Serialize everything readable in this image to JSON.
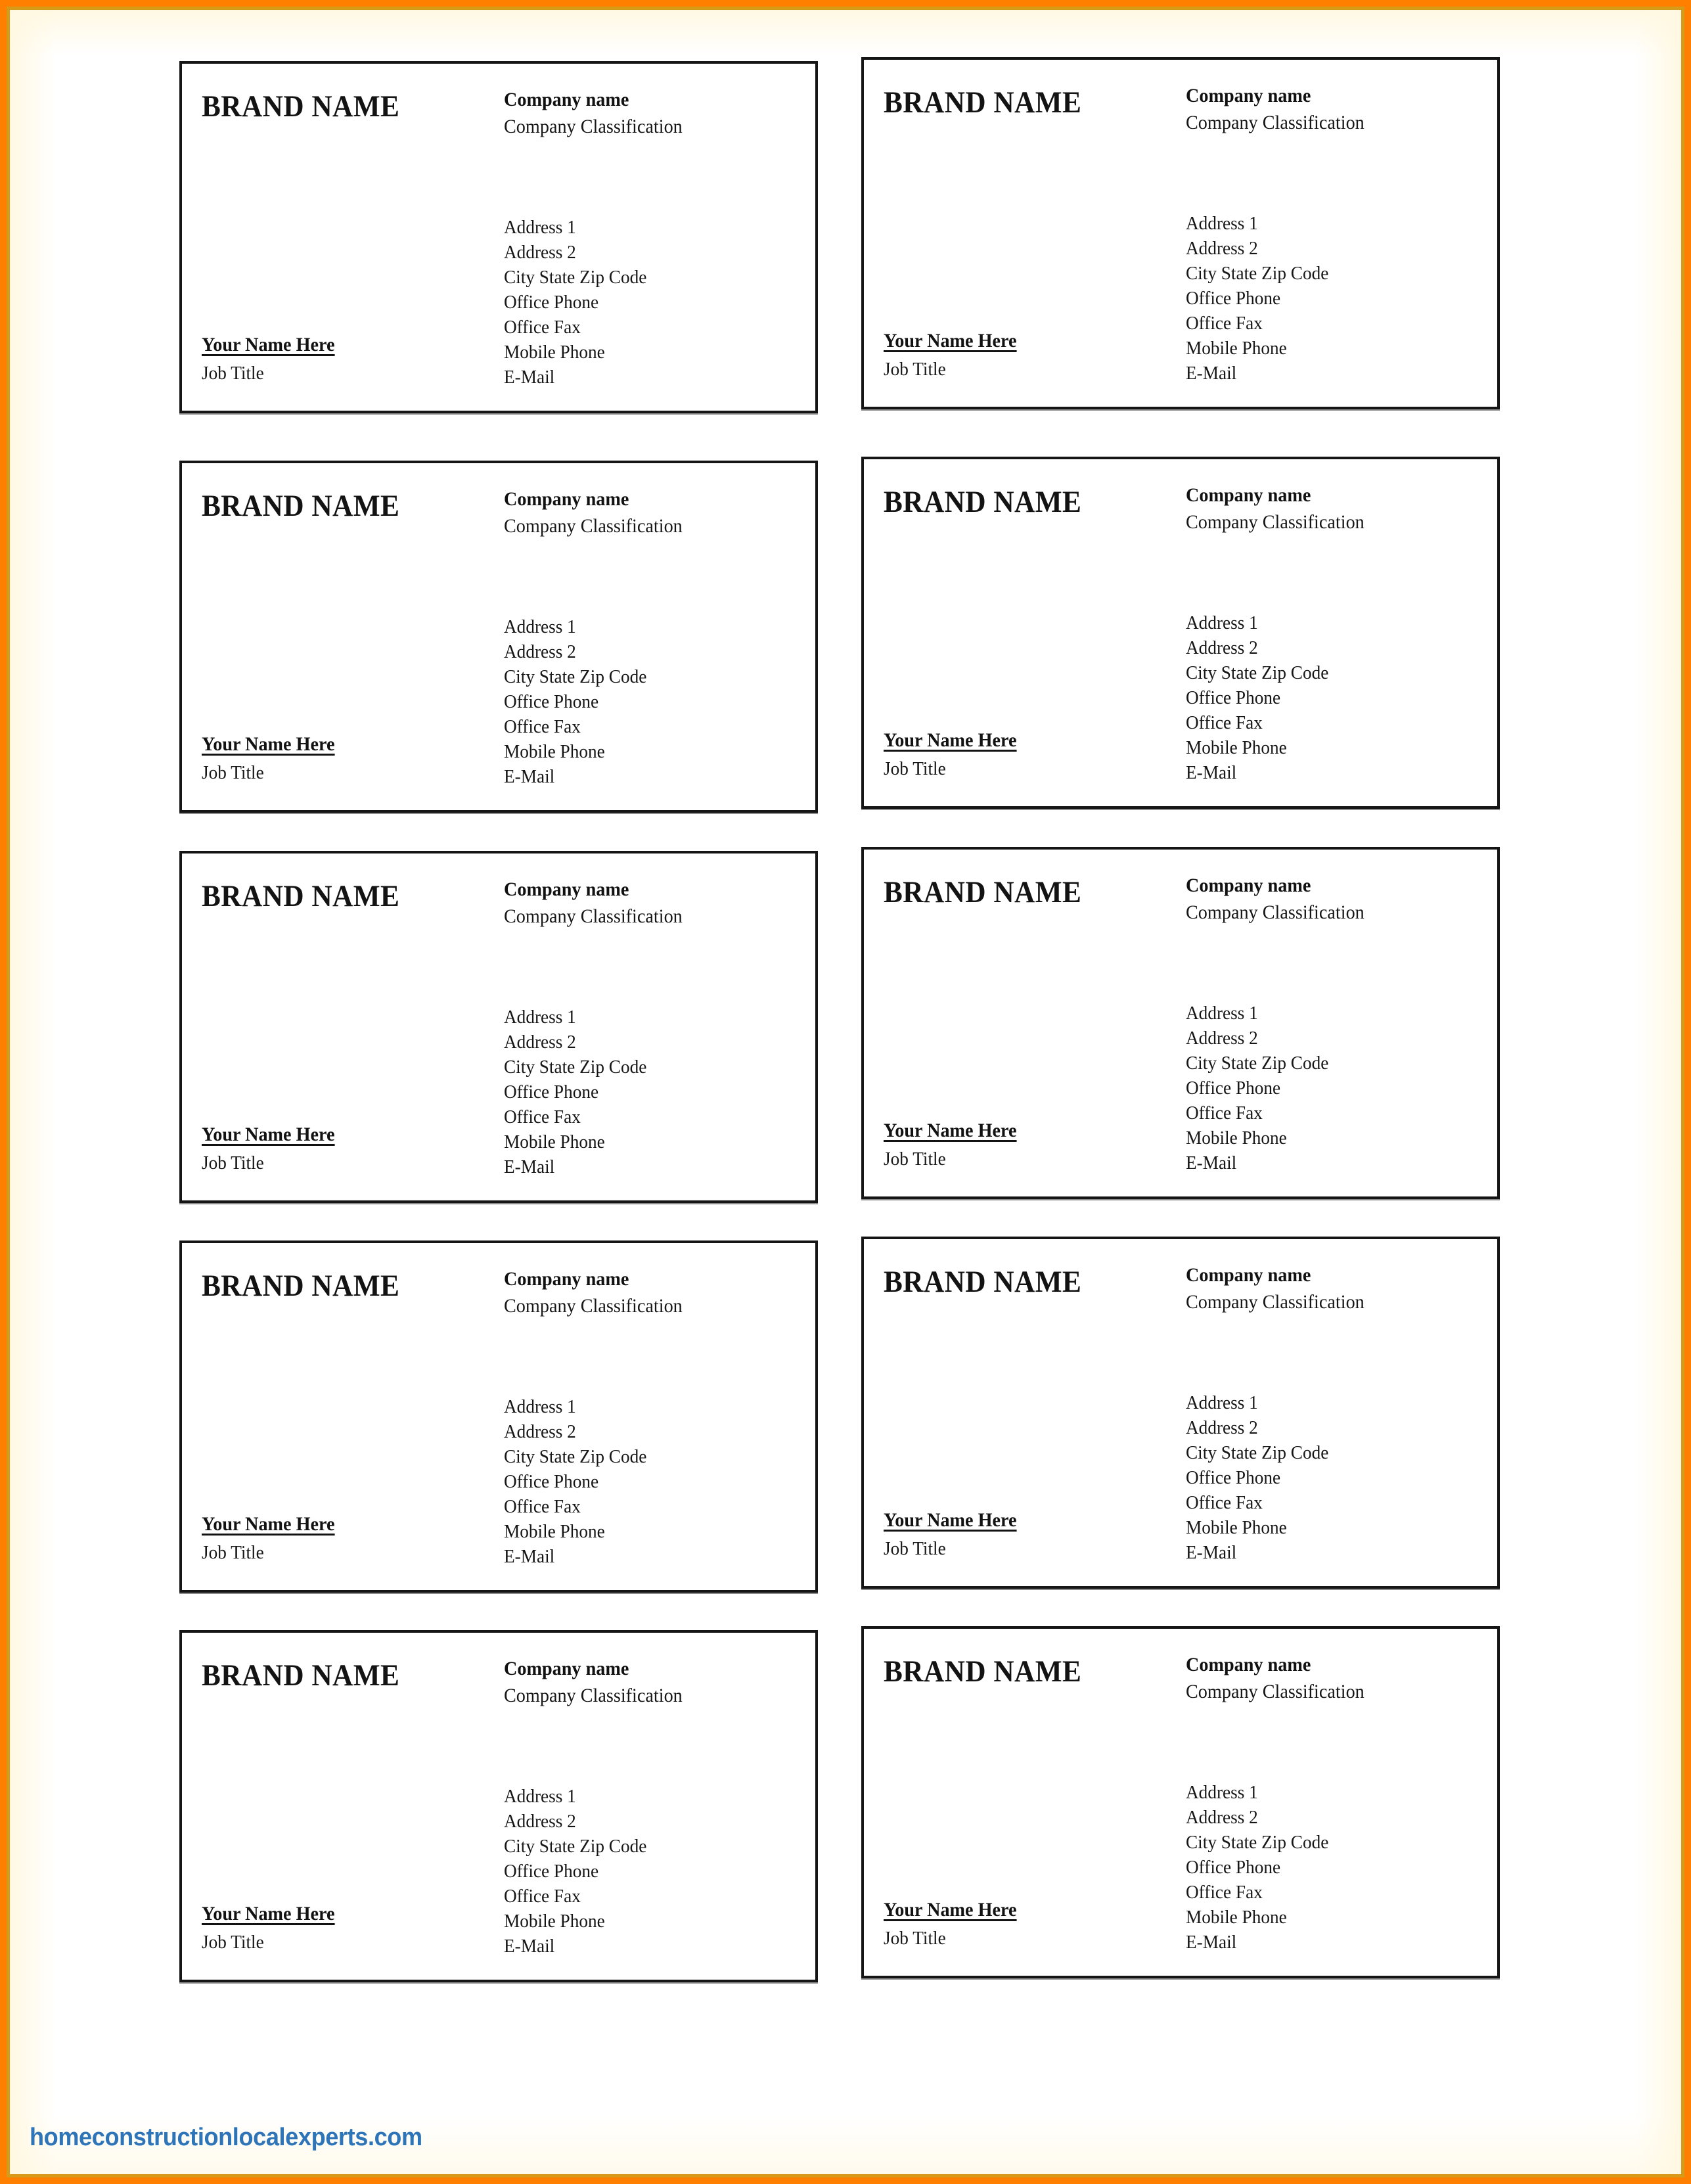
{
  "page": {
    "frame_color": "#ff8000",
    "frame_inner_color": "#d79b18",
    "background": "#ffffff"
  },
  "footer": {
    "site_url": "homeconstructionlocalexperts.com",
    "url_color": "#2d74b8"
  },
  "card_template": {
    "brand_name": "BRAND NAME",
    "company_name": "Company name",
    "company_classification": "Company Classification",
    "person_name": "Your Name Here",
    "job_title": "Job Title",
    "contact_lines": [
      "Address 1",
      "Address 2",
      "City State Zip Code",
      "Office Phone",
      "Office Fax",
      "Mobile Phone",
      "E-Mail"
    ]
  },
  "grid": {
    "columns": 2,
    "rows": 5,
    "total_cards": 10
  },
  "cards": [
    {
      "id": "card-1",
      "column": "left",
      "row": 1,
      "brand_name": "BRAND NAME",
      "company_name": "Company name",
      "company_classification": "Company Classification",
      "person_name": "Your Name Here",
      "job_title": "Job Title",
      "contact_lines": [
        "Address 1",
        "Address 2",
        "City State Zip Code",
        "Office Phone",
        "Office Fax",
        "Mobile Phone",
        "E-Mail"
      ]
    },
    {
      "id": "card-2",
      "column": "right",
      "row": 1,
      "brand_name": "BRAND NAME",
      "company_name": "Company name",
      "company_classification": "Company Classification",
      "person_name": "Your Name Here",
      "job_title": "Job Title",
      "contact_lines": [
        "Address 1",
        "Address 2",
        "City State Zip Code",
        "Office Phone",
        "Office Fax",
        "Mobile Phone",
        "E-Mail"
      ]
    },
    {
      "id": "card-3",
      "column": "left",
      "row": 2,
      "brand_name": "BRAND NAME",
      "company_name": "Company name",
      "company_classification": "Company Classification",
      "person_name": "Your Name Here",
      "job_title": "Job Title",
      "contact_lines": [
        "Address 1",
        "Address 2",
        "City State Zip Code",
        "Office Phone",
        "Office Fax",
        "Mobile Phone",
        "E-Mail"
      ]
    },
    {
      "id": "card-4",
      "column": "right",
      "row": 2,
      "brand_name": "BRAND NAME",
      "company_name": "Company name",
      "company_classification": "Company Classification",
      "person_name": "Your Name Here",
      "job_title": "Job Title",
      "contact_lines": [
        "Address 1",
        "Address 2",
        "City State Zip Code",
        "Office Phone",
        "Office Fax",
        "Mobile Phone",
        "E-Mail"
      ]
    },
    {
      "id": "card-5",
      "column": "left",
      "row": 3,
      "brand_name": "BRAND NAME",
      "company_name": "Company name",
      "company_classification": "Company Classification",
      "person_name": "Your Name Here",
      "job_title": "Job Title",
      "contact_lines": [
        "Address 1",
        "Address 2",
        "City State Zip Code",
        "Office Phone",
        "Office Fax",
        "Mobile Phone",
        "E-Mail"
      ]
    },
    {
      "id": "card-6",
      "column": "right",
      "row": 3,
      "brand_name": "BRAND NAME",
      "company_name": "Company name",
      "company_classification": "Company Classification",
      "person_name": "Your Name Here",
      "job_title": "Job Title",
      "contact_lines": [
        "Address 1",
        "Address 2",
        "City State Zip Code",
        "Office Phone",
        "Office Fax",
        "Mobile Phone",
        "E-Mail"
      ]
    },
    {
      "id": "card-7",
      "column": "left",
      "row": 4,
      "brand_name": "BRAND NAME",
      "company_name": "Company name",
      "company_classification": "Company Classification",
      "person_name": "Your Name Here",
      "job_title": "Job Title",
      "contact_lines": [
        "Address 1",
        "Address 2",
        "City State Zip Code",
        "Office Phone",
        "Office Fax",
        "Mobile Phone",
        "E-Mail"
      ]
    },
    {
      "id": "card-8",
      "column": "right",
      "row": 4,
      "brand_name": "BRAND NAME",
      "company_name": "Company name",
      "company_classification": "Company Classification",
      "person_name": "Your Name Here",
      "job_title": "Job Title",
      "contact_lines": [
        "Address 1",
        "Address 2",
        "City State Zip Code",
        "Office Phone",
        "Office Fax",
        "Mobile Phone",
        "E-Mail"
      ]
    },
    {
      "id": "card-9",
      "column": "left",
      "row": 5,
      "brand_name": "BRAND NAME",
      "company_name": "Company name",
      "company_classification": "Company Classification",
      "person_name": "Your Name Here",
      "job_title": "Job Title",
      "contact_lines": [
        "Address 1",
        "Address 2",
        "City State Zip Code",
        "Office Phone",
        "Office Fax",
        "Mobile Phone",
        "E-Mail"
      ]
    },
    {
      "id": "card-10",
      "column": "right",
      "row": 5,
      "brand_name": "BRAND NAME",
      "company_name": "Company name",
      "company_classification": "Company Classification",
      "person_name": "Your Name Here",
      "job_title": "Job Title",
      "contact_lines": [
        "Address 1",
        "Address 2",
        "City State Zip Code",
        "Office Phone",
        "Office Fax",
        "Mobile Phone",
        "E-Mail"
      ]
    }
  ]
}
